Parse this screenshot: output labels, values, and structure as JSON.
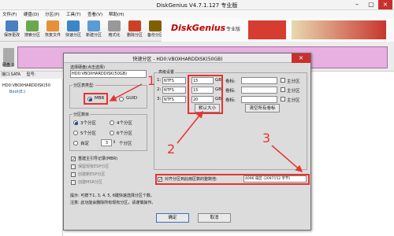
{
  "window": {
    "title": "DiskGenius V4.7.1.127 专业版"
  },
  "menu": [
    "文件(F)",
    "硬盘(D)",
    "分区(P)",
    "工具(T)",
    "查看(V)",
    "帮助(H)"
  ],
  "toolbar": [
    "保存更改",
    "搜索分区",
    "恢复文件",
    "快速分区",
    "新建分区",
    "格式化",
    "删除分区",
    "备份分区"
  ],
  "banner": {
    "brand": "DiskGenius",
    "tag": "专业版"
  },
  "disk_panel": {
    "label": "硬盘 0",
    "iface": "接口:SATA",
    "model": "型号:"
  },
  "tree": [
    "HD0:VBOXHARDDISK(50",
    "Boot(E:)"
  ],
  "dialog": {
    "title": "快速分区 - HD0:VBOXHARDDISK(50GB)",
    "disk_label": "选择硬盘(点击选择)",
    "disk_value": "HD0:VBOXHARDDISK(50GB)",
    "table_type_label": "分区表类型:",
    "mbr": "MBR",
    "guid": "GUID",
    "count_label": "分区数目",
    "counts": [
      "3个分区",
      "4个分区",
      "5个分区",
      "6个分区",
      "自定",
      "个分区"
    ],
    "custom_count": "3",
    "rebuild_mbr": "重建主引导记录(MBR)",
    "keep_esp": "保留现有ESP分区",
    "create_esp": "创建新ESP分区",
    "create_msr": "创建MSR分区",
    "advanced_label": "高级设置",
    "rows": [
      {
        "num": "1:",
        "fs": "NTFS",
        "size": "15",
        "unit": "GB",
        "label_text": "卷标:",
        "primary": "主分区"
      },
      {
        "num": "2:",
        "fs": "NTFS",
        "size": "15",
        "unit": "GB",
        "label_text": "卷标:",
        "primary": "主分区"
      },
      {
        "num": "3:",
        "fs": "NTFS",
        "size": "20",
        "unit": "GB",
        "label_text": "卷标:",
        "primary": "主分区"
      }
    ],
    "default_size_btn": "默认大小",
    "clear_labels_btn": "清空所有卷标",
    "align_label": "对齐分区到此扇区数的整数倍:",
    "align_value": "4096 扇区 (2097152 字节)",
    "tip": "提示: 可按下1, 3, 4, 5, 6键快速选择分区个数。",
    "note": "注意: 此功能会删除所有现有分区，请谨慎操作。",
    "ok": "确定",
    "cancel": "取消"
  },
  "annotations": [
    "1",
    "2",
    "3"
  ],
  "colors": {
    "accent_red": "#e8332f",
    "selection_blue": "#1a4fa0"
  }
}
